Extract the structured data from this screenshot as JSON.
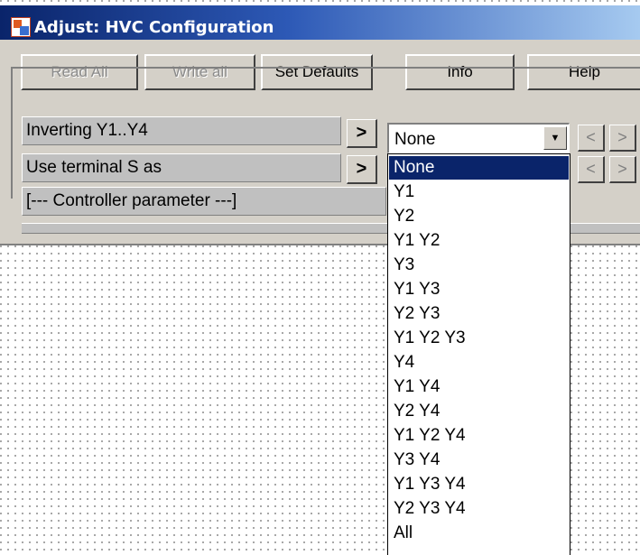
{
  "window": {
    "title": "Adjust: HVC Configuration"
  },
  "toolbar": {
    "read_all": "Read All",
    "write_all": "Write all",
    "set_defaults": "Set Defaults",
    "info": "Info",
    "help": "Help"
  },
  "params": {
    "row1": "Inverting Y1..Y4",
    "row2": "Use terminal S as",
    "row3": "[--- Controller parameter ---]",
    "expand_symbol": ">",
    "nav_prev": "<",
    "nav_next": ">"
  },
  "combo": {
    "value": "None",
    "arrow": "▼"
  },
  "dropdown": {
    "selected": "None",
    "options": [
      "None",
      "Y1",
      "Y2",
      "Y1 Y2",
      "Y3",
      "Y1 Y3",
      "Y2 Y3",
      "Y1 Y2 Y3",
      "Y4",
      "Y1 Y4",
      "Y2 Y4",
      "Y1 Y2 Y4",
      "Y3 Y4",
      "Y1 Y3 Y4",
      "Y2 Y3 Y4",
      "All"
    ]
  },
  "colors": {
    "title_gradient_start": "#0a246a",
    "face": "#d4d0c8",
    "selection": "#0a246a"
  }
}
